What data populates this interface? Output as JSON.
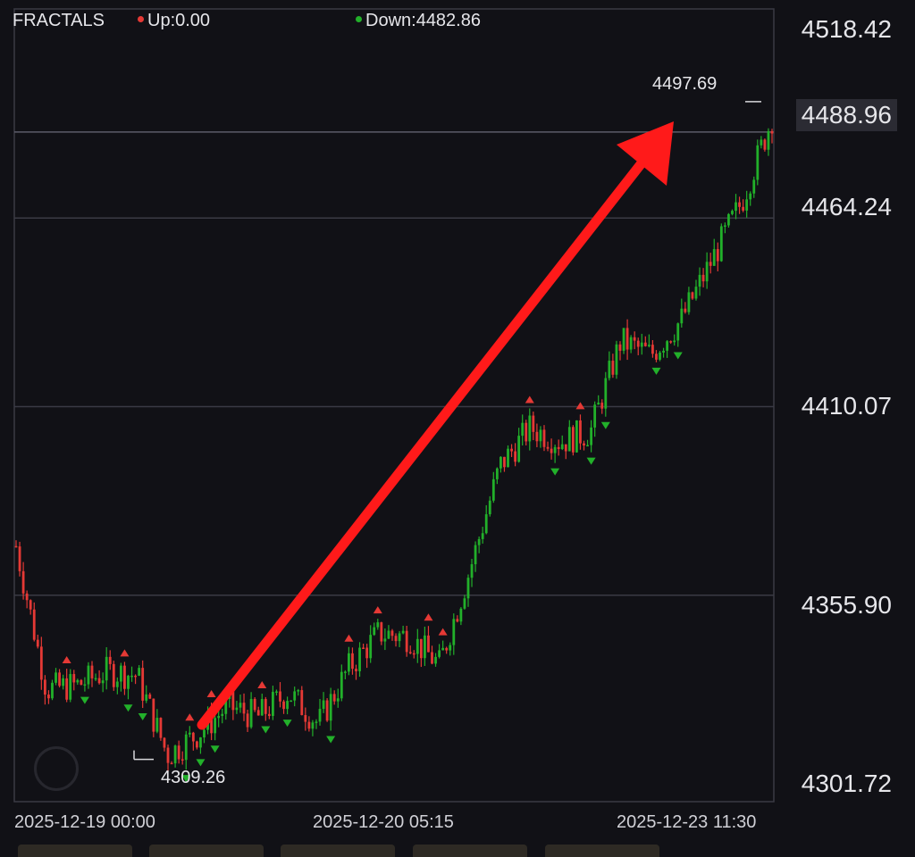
{
  "legend": {
    "indicator": "FRACTALS",
    "up_label": "Up:0.00",
    "down_label": "Down:4482.86",
    "up_color": "#e53935",
    "down_color": "#22b02a"
  },
  "price_axis": {
    "ticks": [
      "4518.42",
      "4488.96",
      "4464.24",
      "4410.07",
      "4355.90",
      "4301.72"
    ],
    "current_price": "4488.96"
  },
  "time_axis": {
    "ticks": [
      "2025-12-19 00:00",
      "2025-12-20 05:15",
      "2025-12-23 11:30"
    ]
  },
  "annotations": {
    "high_label": "4497.69",
    "low_label": "4309.26"
  },
  "colors": {
    "background": "#111116",
    "bull": "#22b02a",
    "bear": "#e53935",
    "arrow": "#ff1a1a",
    "grid": "#3a3a44"
  },
  "chart_data": {
    "type": "line",
    "chart_style": "candlestick with fractal markers",
    "indicator": "FRACTALS",
    "x_range": [
      "2025-12-19 00:00",
      "2025-12-23 11:30"
    ],
    "ylim": [
      4301.72,
      4518.42
    ],
    "grid": true,
    "legend": "top-left",
    "series": [
      {
        "name": "",
        "x": [
          0,
          4,
          8,
          12,
          16,
          20,
          24,
          28,
          32,
          36,
          40,
          44,
          48,
          52,
          56,
          60,
          64,
          68,
          72,
          76,
          80,
          84,
          88,
          92,
          96,
          100
        ],
        "values": [
          4370,
          4329,
          4330,
          4334,
          4333,
          4310,
          4316,
          4324,
          4321,
          4328,
          4319,
          4335,
          4345,
          4344,
          4336,
          4363,
          4393,
          4404,
          4400,
          4403,
          4429,
          4425,
          4435,
          4452,
          4469,
          4493
        ]
      }
    ],
    "fractal_up_markers": 0,
    "fractal_down_markers": 0,
    "current_price": 4488.96,
    "period_high": 4497.69,
    "period_low": 4309.26,
    "trend_arrow": "up"
  }
}
